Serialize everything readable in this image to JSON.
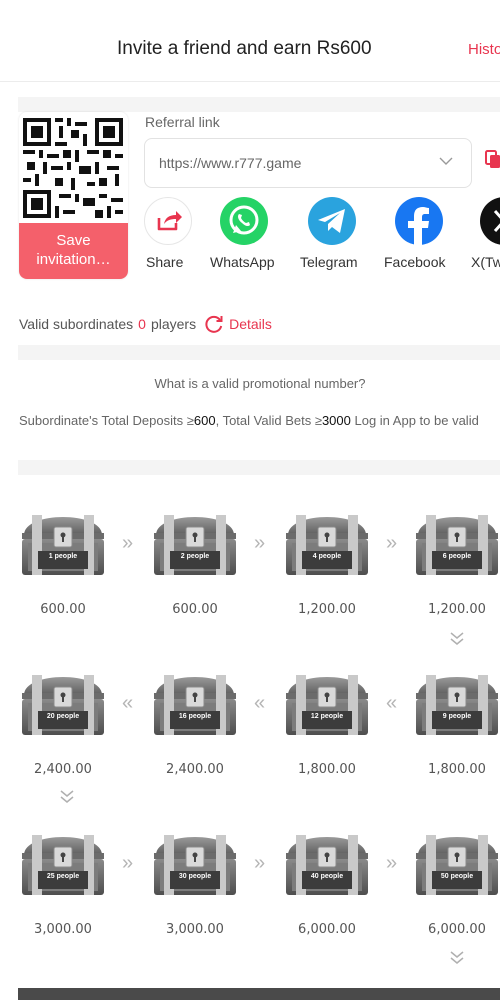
{
  "header": {
    "title": "Invite a friend and earn Rs600",
    "history_label": "Histo"
  },
  "invite": {
    "save_label_line1": "Save",
    "save_label_line2": "invitation…",
    "referral_label": "Referral link",
    "referral_url": "https://www.r777.game",
    "share": [
      {
        "label": "Share",
        "icon": "share-arrow-icon"
      },
      {
        "label": "WhatsApp",
        "icon": "whatsapp-icon"
      },
      {
        "label": "Telegram",
        "icon": "telegram-icon"
      },
      {
        "label": "Facebook",
        "icon": "facebook-icon"
      },
      {
        "label": "X(Tw",
        "icon": "x-twitter-icon"
      }
    ]
  },
  "subordinates": {
    "label": "Valid subordinates",
    "count": "0",
    "unit": "players",
    "details_label": "Details"
  },
  "promo": {
    "question": "What is a valid promotional number?",
    "rule_part1": "Subordinate's Total Deposits ≥",
    "rule_val1": "600",
    "rule_part2": ",  Total Valid Bets ≥",
    "rule_val2": "3000",
    "rule_part3": " Log in App to be valid"
  },
  "rewards": [
    {
      "people": "1 people",
      "amount": "600.00"
    },
    {
      "people": "2 people",
      "amount": "600.00"
    },
    {
      "people": "4 people",
      "amount": "1,200.00"
    },
    {
      "people": "6 people",
      "amount": "1,200.00"
    },
    {
      "people": "20 people",
      "amount": "2,400.00"
    },
    {
      "people": "16 people",
      "amount": "2,400.00"
    },
    {
      "people": "12 people",
      "amount": "1,800.00"
    },
    {
      "people": "9 people",
      "amount": "1,800.00"
    },
    {
      "people": "25 people",
      "amount": "3,000.00"
    },
    {
      "people": "30 people",
      "amount": "3,000.00"
    },
    {
      "people": "40 people",
      "amount": "6,000.00"
    },
    {
      "people": "50 people",
      "amount": "6,000.00"
    }
  ],
  "colors": {
    "accent": "#e8354f",
    "save_button": "#f4606b",
    "whatsapp": "#25d366",
    "telegram": "#2aa3de",
    "facebook": "#1877f2"
  }
}
